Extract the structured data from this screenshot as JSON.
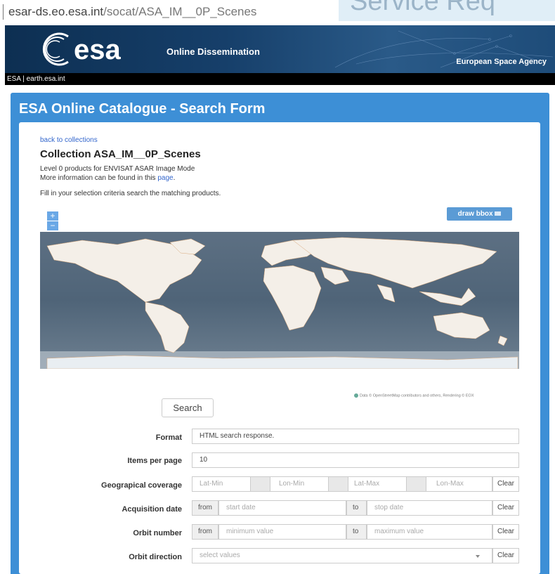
{
  "browser": {
    "url_host": "esar-ds.eo.esa.int",
    "url_path": "/socat/ASA_IM__0P_Scenes"
  },
  "overlay": {
    "heading": "Service Req"
  },
  "banner": {
    "brand": "esa",
    "subtitle": "Online Dissemination",
    "agency": "European Space Agency"
  },
  "topnav": {
    "text": "ESA | earth.esa.int"
  },
  "page": {
    "title": "ESA Online Catalogue - Search Form"
  },
  "collection": {
    "back_link": "back to collections",
    "title": "Collection ASA_IM__0P_Scenes",
    "description": "Level 0 products for ENVISAT ASAR Image Mode",
    "info_prefix": "More information can be found in this ",
    "info_link": "page",
    "info_suffix": ".",
    "instructions": "Fill in your selection criteria search the matching products."
  },
  "map": {
    "zoom_in": "+",
    "zoom_out": "−",
    "draw_bbox": "draw bbox",
    "attribution": "Data © OpenStreetMap contributors and others, Rendering © EOX"
  },
  "search": {
    "label": "Search"
  },
  "form": {
    "format": {
      "label": "Format",
      "value": "HTML search response."
    },
    "items_per_page": {
      "label": "Items per page",
      "value": "10"
    },
    "geo": {
      "label": "Geograpical coverage",
      "lat_min": "Lat-Min",
      "lon_min": "Lon-Min",
      "lat_max": "Lat-Max",
      "lon_max": "Lon-Max",
      "clear": "Clear"
    },
    "acq_date": {
      "label": "Acquisition date",
      "from": "from",
      "start_placeholder": "start date",
      "to": "to",
      "stop_placeholder": "stop date",
      "clear": "Clear"
    },
    "orbit_number": {
      "label": "Orbit number",
      "from": "from",
      "min_placeholder": "minimum value",
      "to": "to",
      "max_placeholder": "maximum value",
      "clear": "Clear"
    },
    "orbit_direction": {
      "label": "Orbit direction",
      "placeholder": "select values",
      "clear": "Clear"
    }
  },
  "colors": {
    "banner": "#163f6a",
    "panel": "#3d8fd6",
    "link": "#3366cc",
    "button": "#5b9bd5"
  }
}
